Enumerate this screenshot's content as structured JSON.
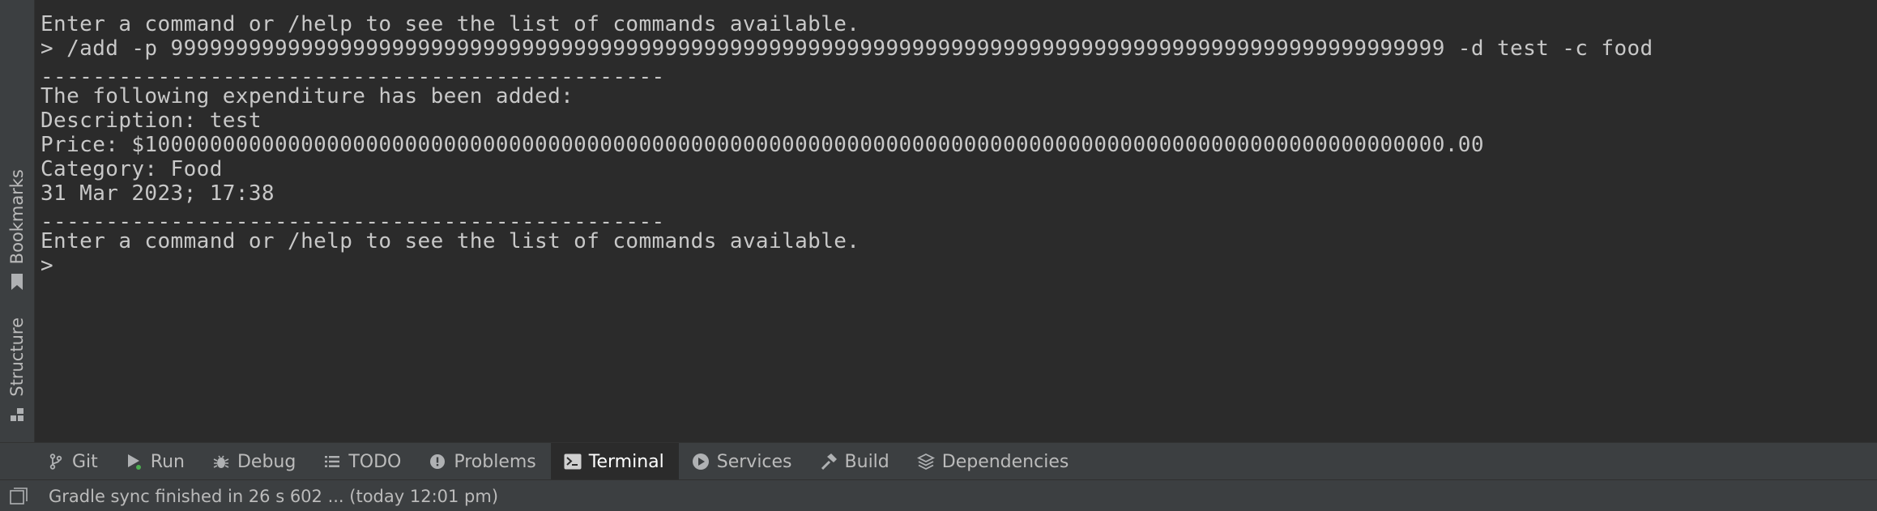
{
  "side_tabs": {
    "bookmarks": {
      "label": "Bookmarks",
      "icon": "bookmark-icon"
    },
    "structure": {
      "label": "Structure",
      "icon": "structure-icon"
    }
  },
  "terminal": {
    "lines": [
      "------------------------------------------------",
      "Enter a command or /help to see the list of commands available.",
      "> /add -p 99999999999999999999999999999999999999999999999999999999999999999999999999999999999999999999999999 -d test -c food",
      "------------------------------------------------",
      "The following expenditure has been added:",
      "Description: test",
      "Price: $1000000000000000000000000000000000000000000000000000000000000000000000000000000000000000000000000000.00",
      "Category: Food",
      "31 Mar 2023; 17:38",
      "------------------------------------------------",
      "Enter a command or /help to see the list of commands available.",
      ">"
    ]
  },
  "tool_tabs": [
    {
      "label": "Git",
      "icon": "git-branch-icon"
    },
    {
      "label": "Run",
      "icon": "run-icon"
    },
    {
      "label": "Debug",
      "icon": "bug-icon"
    },
    {
      "label": "TODO",
      "icon": "todo-list-icon"
    },
    {
      "label": "Problems",
      "icon": "problems-icon"
    },
    {
      "label": "Terminal",
      "icon": "terminal-icon",
      "active": true
    },
    {
      "label": "Services",
      "icon": "services-icon"
    },
    {
      "label": "Build",
      "icon": "hammer-icon"
    },
    {
      "label": "Dependencies",
      "icon": "layers-icon"
    }
  ],
  "status_bar": {
    "text": "Gradle sync finished in 26 s 602 ... (today 12:01 pm)"
  },
  "colors": {
    "terminal_bg": "#2b2b2b",
    "panel_bg": "#3c3f41",
    "text": "#bbbbbb",
    "run_indicator": "#4caf50"
  }
}
